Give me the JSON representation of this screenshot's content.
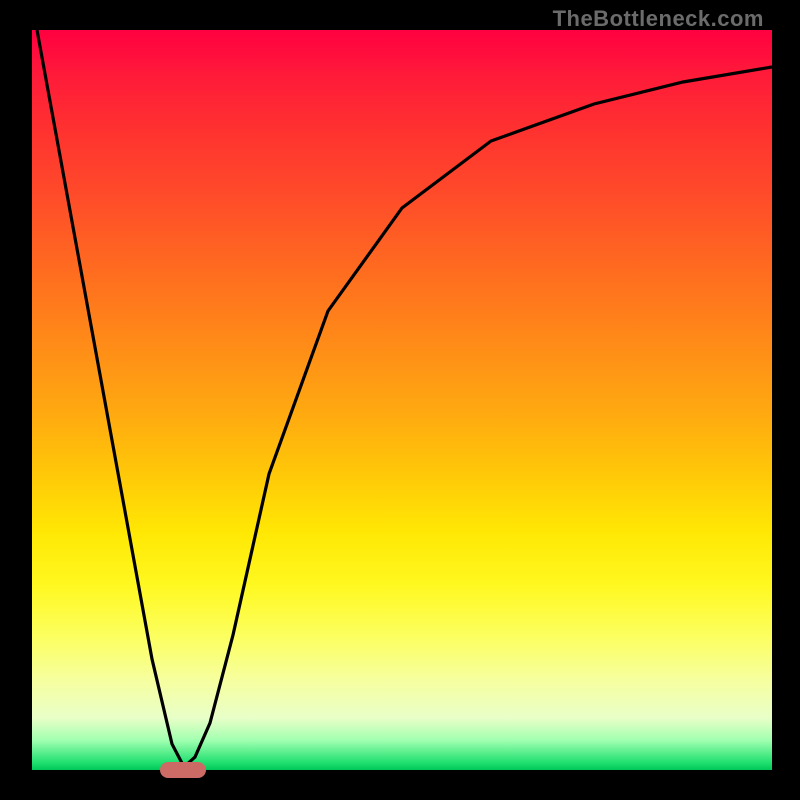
{
  "watermark": "TheBottleneck.com",
  "chart_data": {
    "type": "line",
    "title": "",
    "xlabel": "",
    "ylabel": "",
    "xlim": [
      0,
      100
    ],
    "ylim": [
      0,
      100
    ],
    "background_gradient": {
      "top_color": "#ff0040",
      "mid_color": "#ffe000",
      "bottom_color": "#00c858"
    },
    "series": [
      {
        "name": "bottleneck-curve",
        "x": [
          0,
          16,
          19,
          21,
          22,
          24,
          27,
          32,
          40,
          50,
          62,
          76,
          88,
          100
        ],
        "values": [
          100,
          15,
          3,
          0,
          1,
          6,
          18,
          40,
          62,
          76,
          85,
          90,
          93,
          95
        ]
      }
    ],
    "annotations": [
      {
        "name": "optimal-zone-marker",
        "x_center_pct": 20.5,
        "width_pct": 6,
        "color": "#cc6b66"
      }
    ]
  },
  "colors": {
    "frame": "#000000",
    "curve_stroke": "#000000",
    "marker_fill": "#cc6b66"
  }
}
